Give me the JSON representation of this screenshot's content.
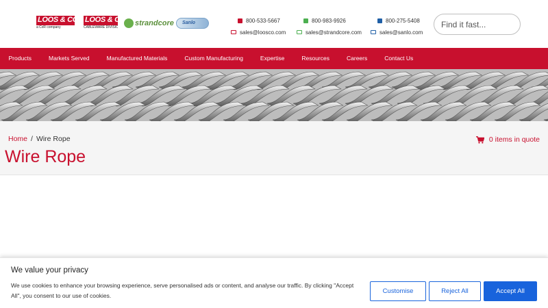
{
  "header": {
    "logos": [
      {
        "main": "LOOS & CO.",
        "sub": "a CxR company"
      },
      {
        "main": "LOOS & CO.",
        "sub": "CABLEWARE DIVISION"
      },
      {
        "main": "strandcore"
      },
      {
        "main": "Sanlo"
      }
    ],
    "contacts": [
      {
        "phone": "800-533-5667",
        "email": "sales@loosco.com",
        "color": "#c8102e"
      },
      {
        "phone": "800-983-9926",
        "email": "sales@strandcore.com",
        "color": "#4caf50"
      },
      {
        "phone": "800-275-5408",
        "email": "sales@sanlo.com",
        "color": "#1f5fa6"
      }
    ],
    "search": {
      "placeholder": "Find it fast..."
    }
  },
  "nav": {
    "items": [
      {
        "label": "Products"
      },
      {
        "label": "Markets Served"
      },
      {
        "label": "Manufactured Materials"
      },
      {
        "label": "Custom Manufacturing"
      },
      {
        "label": "Expertise"
      },
      {
        "label": "Resources"
      },
      {
        "label": "Careers"
      },
      {
        "label": "Contact Us"
      }
    ]
  },
  "breadcrumb": {
    "home": "Home",
    "separator": "/",
    "current": "Wire Rope"
  },
  "page": {
    "title": "Wire Rope",
    "quote": "0 items in quote"
  },
  "cookie": {
    "title": "We value your privacy",
    "text": "We use cookies to enhance your browsing experience, serve personalised ads or content, and analyse our traffic. By clicking \"Accept All\", you consent to our use of cookies.",
    "customise": "Customise",
    "reject": "Reject All",
    "accept": "Accept All"
  },
  "colors": {
    "brand_red": "#c8102e",
    "accept_blue": "#1863dc"
  },
  "icons": {
    "cart": "cart-icon",
    "phone": "phone-icon",
    "mail": "mail-icon"
  }
}
